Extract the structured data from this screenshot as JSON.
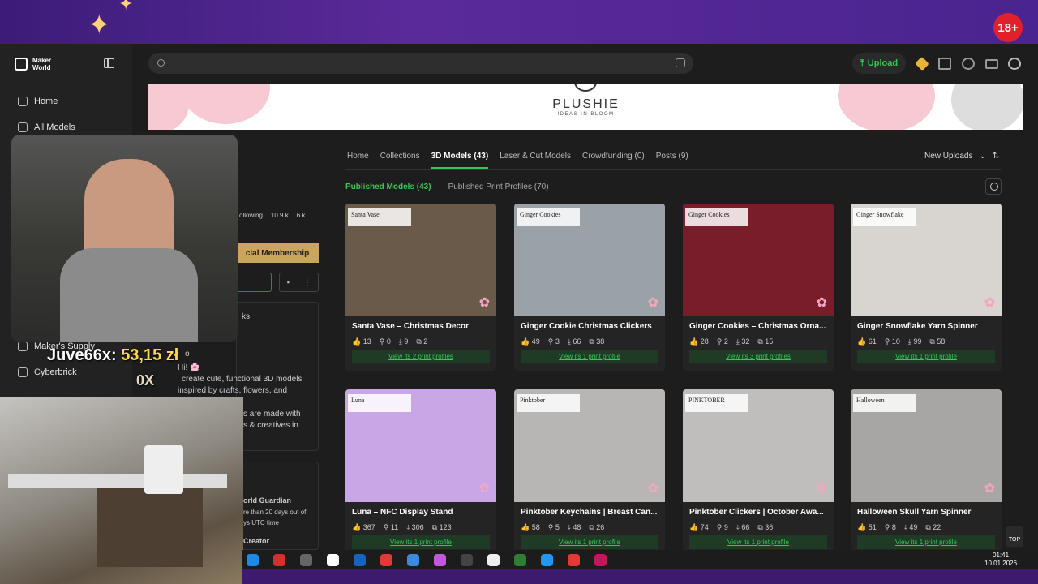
{
  "overlay": {
    "age_badge": "18+",
    "donation_user": "Juve66x:",
    "donation_amount": "53,15 zł",
    "donation_count": "0X"
  },
  "sidebar": {
    "logo_line1": "Maker",
    "logo_line2": "World",
    "items": [
      {
        "label": "Home",
        "icon": "home-icon"
      },
      {
        "label": "All Models",
        "icon": "models-icon"
      },
      {
        "label": "Maker's Supply",
        "icon": "supply-icon"
      },
      {
        "label": "Cyberbrick",
        "icon": "cyberbrick-icon"
      }
    ]
  },
  "topbar": {
    "search_placeholder": "",
    "upload_label": "Upload"
  },
  "banner": {
    "title": "PLUSHIE",
    "subtitle": "IDEAS IN BLOOM"
  },
  "profile": {
    "following_label": "ollowing",
    "stat_a": "10.9 k",
    "stat_b": "6 k",
    "membership_label": "cial Membership",
    "section_ks": "ks",
    "section_o": "o",
    "bio_greeting": "Hi! 🌸",
    "bio_line1": "create cute, functional 3D models",
    "bio_line2": "inspired by crafts, flowers, and",
    "bio_line3": "s are made with",
    "bio_line4": "s & creatives in",
    "badge_title": "orld Guardian",
    "badge_line1": "re than 20 days out of",
    "badge_line2": "ys UTC time",
    "badge2_title": "Creator"
  },
  "tabs": [
    {
      "label": "Home",
      "active": false
    },
    {
      "label": "Collections",
      "active": false
    },
    {
      "label": "3D Models (43)",
      "active": true
    },
    {
      "label": "Laser & Cut Models",
      "active": false
    },
    {
      "label": "Crowdfunding (0)",
      "active": false
    },
    {
      "label": "Posts (9)",
      "active": false
    }
  ],
  "sort_label": "New Uploads",
  "subtabs": {
    "published": "Published Models (43)",
    "profiles": "Published Print Profiles (70)"
  },
  "models": [
    {
      "tag": "Santa Vase",
      "name": "Santa Vase – Christmas Decor",
      "likes": "13",
      "boosts": "0",
      "downloads": "9",
      "prints": "2",
      "profiles": "View its 2 print profiles",
      "bg": "#6a5a4a"
    },
    {
      "tag": "Ginger Cookies",
      "name": "Ginger Cookie Christmas Clickers",
      "likes": "49",
      "boosts": "3",
      "downloads": "66",
      "prints": "38",
      "profiles": "View its 1 print profile",
      "bg": "#9aa2a8"
    },
    {
      "tag": "Ginger Cookies",
      "name": "Ginger Cookies – Christmas Orna...",
      "likes": "28",
      "boosts": "2",
      "downloads": "32",
      "prints": "15",
      "profiles": "View its 3 print profiles",
      "bg": "#7a1d2a"
    },
    {
      "tag": "Ginger Snowflake",
      "name": "Ginger Snowflake Yarn Spinner",
      "likes": "61",
      "boosts": "10",
      "downloads": "99",
      "prints": "58",
      "profiles": "View its 1 print profile",
      "bg": "#d8d4d0"
    },
    {
      "tag": "Luna",
      "name": "Luna – NFC Display Stand",
      "likes": "367",
      "boosts": "11",
      "downloads": "306",
      "prints": "123",
      "profiles": "View its 1 print profile",
      "bg": "#c9a6e6"
    },
    {
      "tag": "Pinktober",
      "name": "Pinktober Keychains | Breast Can...",
      "likes": "58",
      "boosts": "5",
      "downloads": "48",
      "prints": "26",
      "profiles": "View its 1 print profile",
      "bg": "#b8b6b4"
    },
    {
      "tag": "PINKTOBER",
      "name": "Pinktober Clickers | October Awa...",
      "likes": "74",
      "boosts": "9",
      "downloads": "66",
      "prints": "36",
      "profiles": "View its 1 print profile",
      "bg": "#c0bebc"
    },
    {
      "tag": "Halloween",
      "name": "Halloween Skull Yarn Spinner",
      "likes": "51",
      "boosts": "8",
      "downloads": "49",
      "prints": "22",
      "profiles": "View its 1 print profile",
      "bg": "#a8a6a4"
    }
  ],
  "to_top_label": "TOP",
  "clock": {
    "time": "01:41",
    "date": "10.01.2026"
  },
  "colors": {
    "accent": "#34c759",
    "membership": "#caa55a",
    "stream_bg": "#3d1a6e"
  }
}
